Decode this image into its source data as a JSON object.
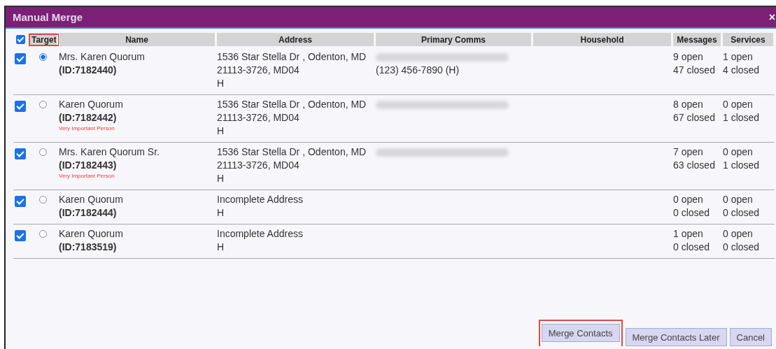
{
  "window": {
    "title": "Manual Merge",
    "close": "×"
  },
  "table": {
    "select_all_checked": true,
    "columns": [
      {
        "label": "Target",
        "highlighted": true
      },
      {
        "label": "Name",
        "highlighted": false
      },
      {
        "label": "Address",
        "highlighted": false
      },
      {
        "label": "Primary Comms",
        "highlighted": false
      },
      {
        "label": "Household",
        "highlighted": false
      },
      {
        "label": "Messages",
        "highlighted": false
      },
      {
        "label": "Services",
        "highlighted": false
      }
    ],
    "rows": [
      {
        "checked": true,
        "selected": true,
        "name": "Mrs. Karen Quorum",
        "id": "(ID:7182440)",
        "address": [
          "1536 Star Stella Dr , Odenton, MD",
          "21113-3726, MD04",
          "H"
        ],
        "email_blurred": true,
        "phone": "(123) 456-7890 (H)",
        "messages": [
          "9 open",
          "47 closed"
        ],
        "services": [
          "1 open",
          "4 closed"
        ]
      },
      {
        "checked": true,
        "selected": false,
        "name": "Karen Quorum",
        "id": "(ID:7182442)",
        "tag": "Very Important Person",
        "address": [
          "1536 Star Stella Dr , Odenton, MD",
          "21113-3726, MD04",
          "H"
        ],
        "email_blurred": true,
        "messages": [
          "8 open",
          "67 closed"
        ],
        "services": [
          "0 open",
          "1 closed"
        ]
      },
      {
        "checked": true,
        "selected": false,
        "name": "Mrs. Karen Quorum Sr.",
        "id": "(ID:7182443)",
        "tag": "Very Important Person",
        "address": [
          "1536 Star Stella Dr , Odenton, MD",
          "21113-3726, MD04",
          "H"
        ],
        "email_blurred": true,
        "messages": [
          "7 open",
          "63 closed"
        ],
        "services": [
          "0 open",
          "1 closed"
        ]
      },
      {
        "checked": true,
        "selected": false,
        "name": "Karen Quorum",
        "id": "(ID:7182444)",
        "address": [
          "Incomplete Address",
          "H"
        ],
        "email_blurred": false,
        "messages": [
          "0 open",
          "0 closed"
        ],
        "services": [
          "0 open",
          "0 closed"
        ]
      },
      {
        "checked": true,
        "selected": false,
        "name": "Karen Quorum",
        "id": "(ID:7183519)",
        "address": [
          "Incomplete Address",
          "H"
        ],
        "email_blurred": false,
        "messages": [
          "1 open",
          "0 closed"
        ],
        "services": [
          "0 open",
          "0 closed"
        ]
      }
    ]
  },
  "buttons": [
    {
      "label": "Merge Contacts",
      "highlighted": true
    },
    {
      "label": "Merge Contacts Later",
      "highlighted": false
    },
    {
      "label": "Cancel",
      "highlighted": false
    }
  ]
}
